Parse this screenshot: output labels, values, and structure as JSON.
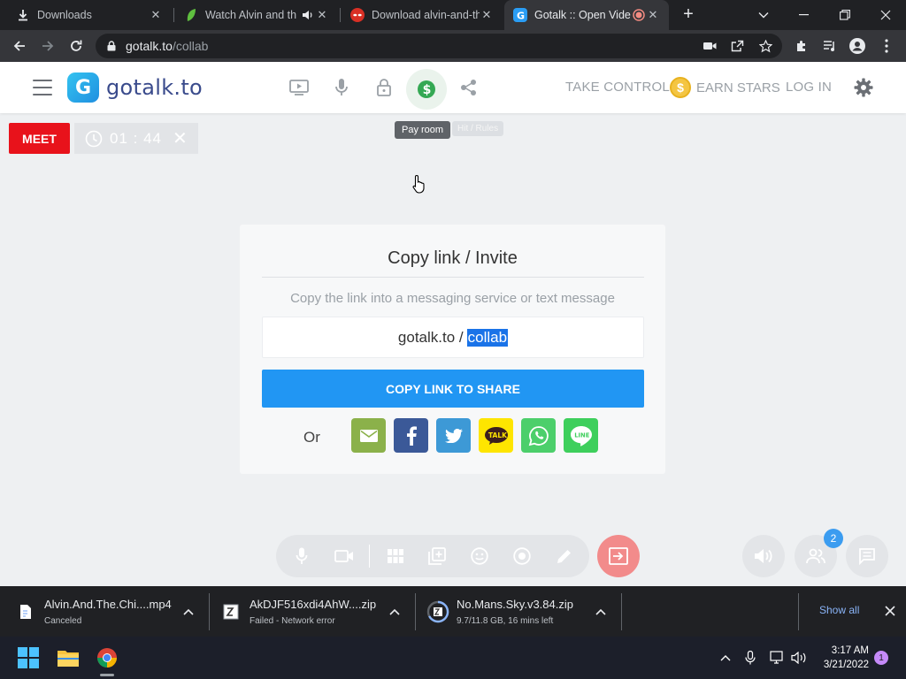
{
  "browser": {
    "tabs": [
      {
        "title": "Downloads",
        "icon": "download-icon"
      },
      {
        "title": "Watch Alvin and th",
        "icon": "green-leaf-icon",
        "audio_icon": "speaker-icon"
      },
      {
        "title": "Download alvin-and-th",
        "icon": "red-mask-icon"
      },
      {
        "title": "Gotalk :: Open Vide",
        "icon": "gotalk-logo-icon",
        "recording_icon": "record-icon"
      }
    ],
    "url_host": "gotalk.to",
    "url_path": "/collab"
  },
  "site": {
    "logo_letter": "G",
    "logo_text": "gotalk.to",
    "take_control": "TAKE CONTROL",
    "coin_symbol": "$",
    "earn_stars": "EARN STARS",
    "log_in": "LOG IN",
    "tooltip": "Pay room",
    "tooltip_faded": "Hit / Rules"
  },
  "session": {
    "meet_label": "MEET",
    "timer": "01 : 44"
  },
  "invite": {
    "title": "Copy link / Invite",
    "subtitle": "Copy the link into a messaging service or text message",
    "link_host": "gotalk.to /",
    "link_room": "collab",
    "copy_button": "COPY LINK TO SHARE",
    "or_label": "Or",
    "share_targets": [
      {
        "name": "email",
        "color": "#8bb14a"
      },
      {
        "name": "facebook",
        "color": "#3b5998"
      },
      {
        "name": "twitter",
        "color": "#3d99d6"
      },
      {
        "name": "kakaotalk",
        "color": "#fee500",
        "label": "TALK"
      },
      {
        "name": "whatsapp",
        "color": "#4ccf6b"
      },
      {
        "name": "line",
        "color": "#3ecf5c",
        "label": "LINE"
      }
    ]
  },
  "controls": {
    "participants_count": "2"
  },
  "downloads": [
    {
      "name": "Alvin.And.The.Chi....mp4",
      "status": "Canceled"
    },
    {
      "name": "AkDJF516xdi4AhW....zip",
      "status": "Failed - Network error"
    },
    {
      "name": "No.Mans.Sky.v3.84.zip",
      "status": "9.7/11.8 GB, 16 mins left"
    }
  ],
  "shelf": {
    "show_all": "Show all"
  },
  "taskbar": {
    "time": "3:17 AM",
    "date": "3/21/2022",
    "notifications": "1"
  },
  "colors": {
    "meet_red": "#e8121b",
    "copy_blue": "#2196f3",
    "leave_red": "#f28b8b",
    "badge_blue": "#3b9cf0"
  }
}
